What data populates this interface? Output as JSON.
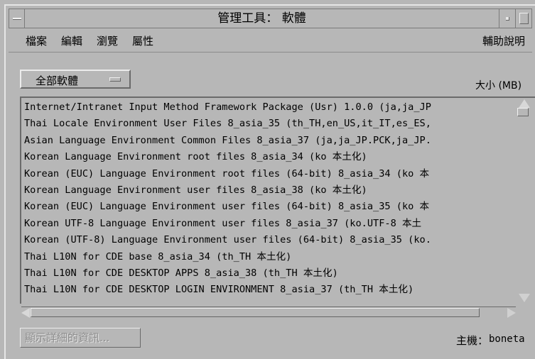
{
  "window": {
    "title": "管理工具： 軟體"
  },
  "menubar": {
    "file": "檔案",
    "edit": "編輯",
    "browse": "瀏覽",
    "properties": "屬性",
    "help": "輔助說明"
  },
  "filter": {
    "selected": "全部軟體"
  },
  "size_header": "大小 (MB)",
  "packages": [
    "Internet/Intranet Input Method Framework Package (Usr) 1.0.0 (ja,ja_JP",
    "Thai Locale Environment User Files 8_asia_35 (th_TH,en_US,it_IT,es_ES,",
    "Asian Language Environment Common Files 8_asia_37 (ja,ja_JP.PCK,ja_JP.",
    "Korean Language Environment root files 8_asia_34 (ko 本土化)",
    "Korean (EUC) Language Environment root files (64-bit) 8_asia_34 (ko 本",
    "Korean Language Environment user files 8_asia_38 (ko 本土化)",
    "Korean (EUC) Language Environment user files (64-bit) 8_asia_35 (ko 本",
    "Korean UTF-8 Language Environment user files 8_asia_37 (ko.UTF-8 本土",
    "Korean (UTF-8) Language Environment user files (64-bit) 8_asia_35 (ko.",
    "Thai L10N for CDE base 8_asia_34 (th_TH 本土化)",
    "Thai L10N for CDE DESKTOP APPS 8_asia_38 (th_TH 本土化)",
    "Thai L10N for CDE DESKTOP LOGIN ENVIRONMENT 8_asia_37 (th_TH 本土化)"
  ],
  "details_button": "顯示詳細的資訊...",
  "host": {
    "label": "主機：",
    "value": "boneta"
  }
}
